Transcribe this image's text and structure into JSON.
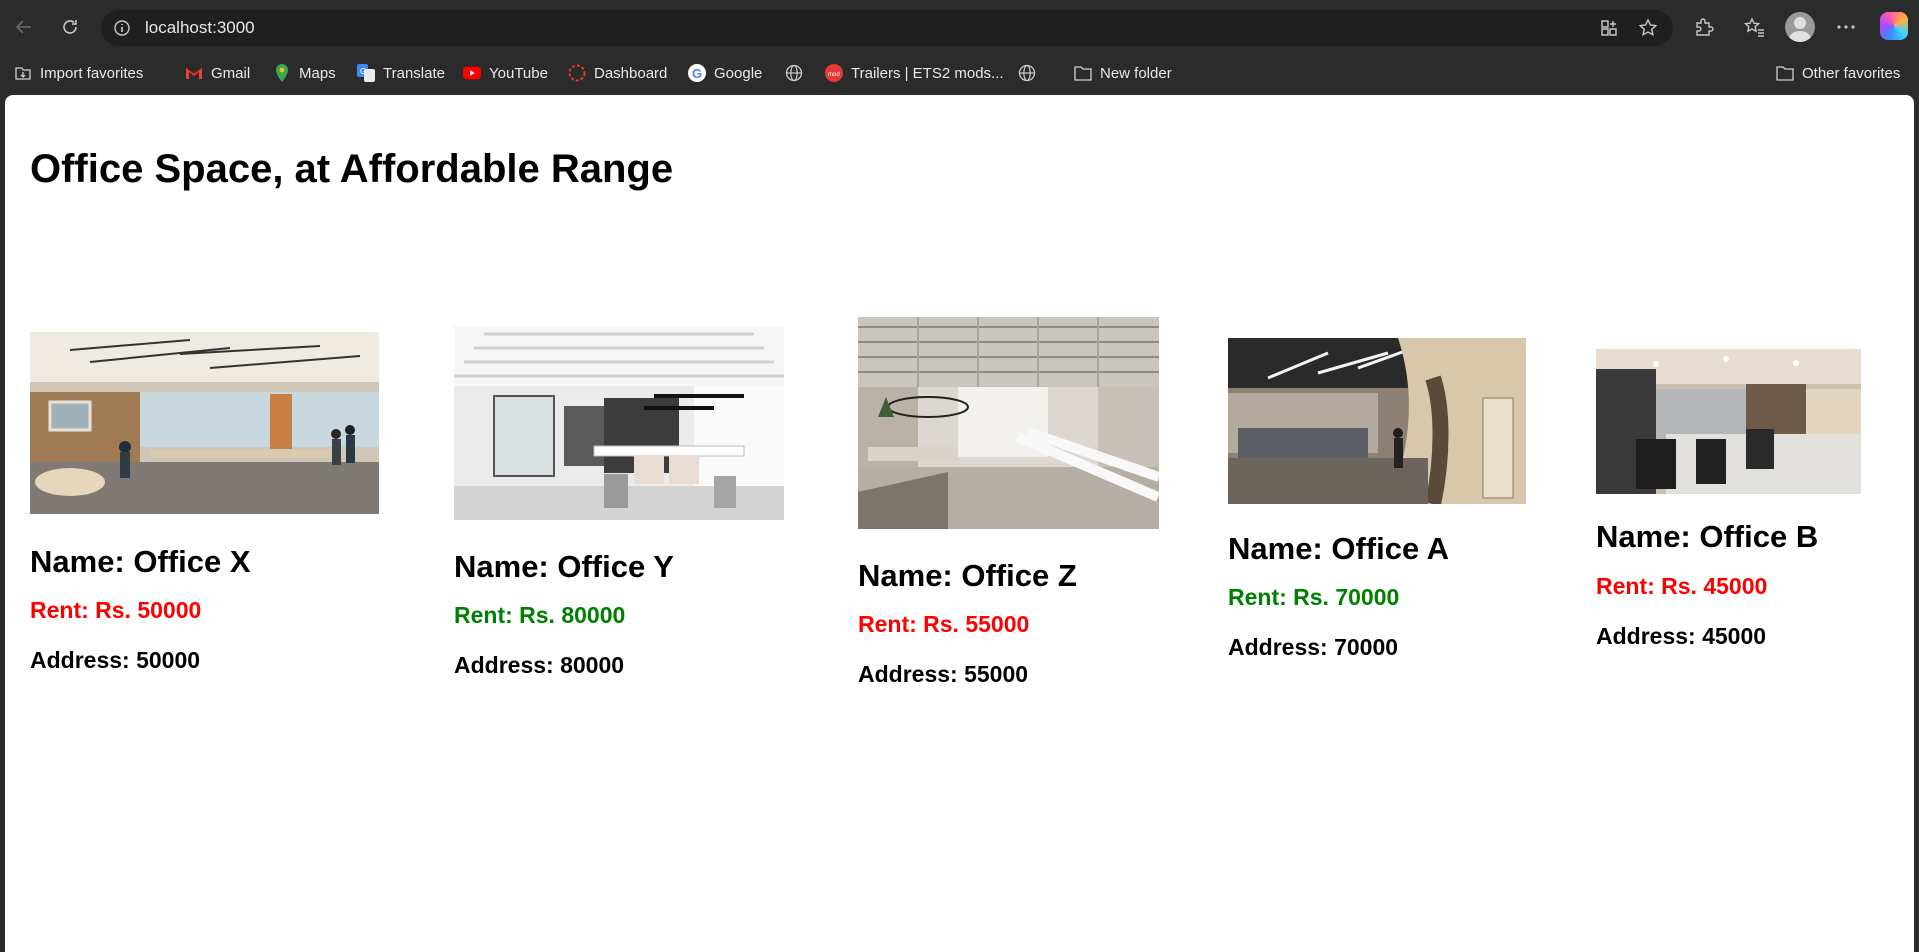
{
  "browser": {
    "url": "localhost:3000",
    "bookmarks": [
      {
        "label": "Import favorites",
        "icon": "import-icon"
      },
      {
        "label": "Gmail",
        "icon": "gmail-icon"
      },
      {
        "label": "Maps",
        "icon": "maps-icon"
      },
      {
        "label": "Translate",
        "icon": "translate-icon"
      },
      {
        "label": "YouTube",
        "icon": "youtube-icon"
      },
      {
        "label": "Dashboard",
        "icon": "dashboard-icon"
      },
      {
        "label": "Google",
        "icon": "google-icon"
      },
      {
        "label": "",
        "icon": "globe-icon"
      },
      {
        "label": "Trailers | ETS2 mods...",
        "icon": "ets2-icon"
      },
      {
        "label": "",
        "icon": "globe-icon"
      },
      {
        "label": "New folder",
        "icon": "folder-icon"
      },
      {
        "label": "Other favorites",
        "icon": "folder-icon"
      }
    ]
  },
  "page": {
    "title": "Office Space, at Affordable Range",
    "offices": [
      {
        "name": "Name: Office X",
        "rent": "Rent: Rs. 50000",
        "address": "Address: 50000",
        "rent_color": "#ff0000"
      },
      {
        "name": "Name: Office Y",
        "rent": "Rent: Rs. 80000",
        "address": "Address: 80000",
        "rent_color": "#008000"
      },
      {
        "name": "Name: Office Z",
        "rent": "Rent: Rs. 55000",
        "address": "Address: 55000",
        "rent_color": "#ff0000"
      },
      {
        "name": "Name: Office A",
        "rent": "Rent: Rs. 70000",
        "address": "Address: 70000",
        "rent_color": "#008000"
      },
      {
        "name": "Name: Office B",
        "rent": "Rent: Rs. 45000",
        "address": "Address: 45000",
        "rent_color": "#ff0000"
      }
    ]
  }
}
